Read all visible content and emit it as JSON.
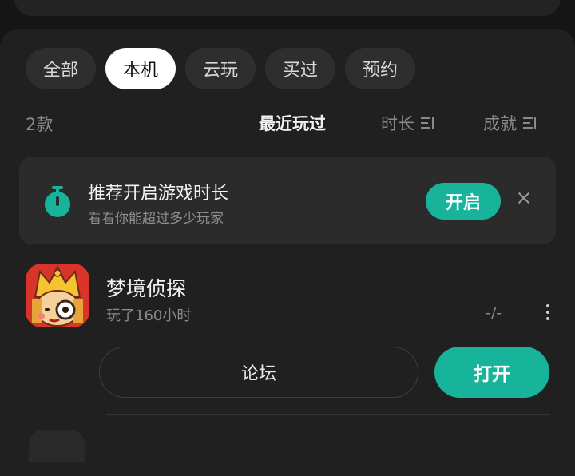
{
  "tabs": [
    {
      "label": "全部",
      "active": false
    },
    {
      "label": "本机",
      "active": true
    },
    {
      "label": "云玩",
      "active": false
    },
    {
      "label": "买过",
      "active": false
    },
    {
      "label": "预约",
      "active": false
    }
  ],
  "list": {
    "count": "2款",
    "sort_options": [
      "最近玩过",
      "时长",
      "成就"
    ],
    "selected_sort": "最近玩过"
  },
  "banner": {
    "title": "推荐开启游戏时长",
    "subtitle": "看看你能超过多少玩家",
    "enable_label": "开启",
    "icon": "timer-icon",
    "close_icon": "close-icon"
  },
  "games": [
    {
      "name": "梦境侦探",
      "played": "玩了160小时",
      "achievement": "-/-",
      "forum_label": "论坛",
      "open_label": "打开",
      "icon": "game-icon",
      "more_icon": "more-icon"
    }
  ],
  "colors": {
    "accent": "#18b39b",
    "background": "#151515",
    "panel": "#202020",
    "card": "#2b2b2b"
  }
}
